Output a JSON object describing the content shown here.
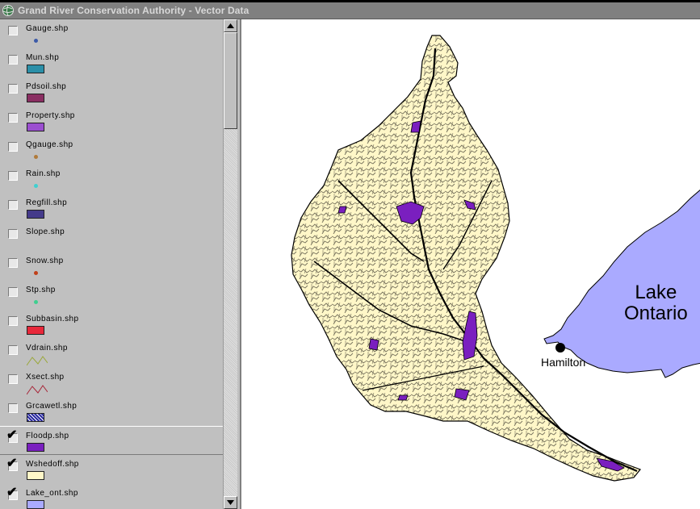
{
  "window": {
    "title": "Grand River Conservation Authority - Vector Data"
  },
  "legend": {
    "layers": [
      {
        "name": "Gauge.shp",
        "checked": false,
        "symbol": "point",
        "color": "#3b5aa8"
      },
      {
        "name": "Mun.shp",
        "checked": false,
        "symbol": "fill",
        "color": "#2b8fa8"
      },
      {
        "name": "Pdsoil.shp",
        "checked": false,
        "symbol": "fill",
        "color": "#8a2e62"
      },
      {
        "name": "Property.shp",
        "checked": false,
        "symbol": "fill",
        "color": "#9b4fd0"
      },
      {
        "name": "Qgauge.shp",
        "checked": false,
        "symbol": "point",
        "color": "#b07a3a"
      },
      {
        "name": "Rain.shp",
        "checked": false,
        "symbol": "point",
        "color": "#3fd0d0"
      },
      {
        "name": "Regfill.shp",
        "checked": false,
        "symbol": "fill",
        "color": "#443a8a"
      },
      {
        "name": "Slope.shp",
        "checked": false,
        "symbol": "none",
        "color": ""
      },
      {
        "name": "Snow.shp",
        "checked": false,
        "symbol": "point",
        "color": "#c0401a"
      },
      {
        "name": "Stp.shp",
        "checked": false,
        "symbol": "point",
        "color": "#3fcf8f"
      },
      {
        "name": "Subbasin.shp",
        "checked": false,
        "symbol": "fill",
        "color": "#e8283a"
      },
      {
        "name": "Vdrain.shp",
        "checked": false,
        "symbol": "line",
        "color": "#9aa83a"
      },
      {
        "name": "Xsect.shp",
        "checked": false,
        "symbol": "line",
        "color": "#a8283a"
      },
      {
        "name": "Grcawetl.shp",
        "checked": false,
        "symbol": "hatch",
        "color": "#2a2aa0"
      },
      {
        "name": "Floodp.shp",
        "checked": true,
        "symbol": "fill",
        "color": "#7a1fbf"
      },
      {
        "name": "Wshedoff.shp",
        "checked": true,
        "symbol": "fill",
        "color": "#fff7c8"
      },
      {
        "name": "Lake_ont.shp",
        "checked": true,
        "symbol": "fill",
        "color": "#aaaaff"
      }
    ]
  },
  "map": {
    "lake_label_line1": "Lake",
    "lake_label_line2": "Ontario",
    "city_label": "Hamilton",
    "colors": {
      "watershed": "#fff7c8",
      "floodplain": "#7a1fbf",
      "lake": "#aaaaff",
      "rivers": "#000000"
    }
  }
}
